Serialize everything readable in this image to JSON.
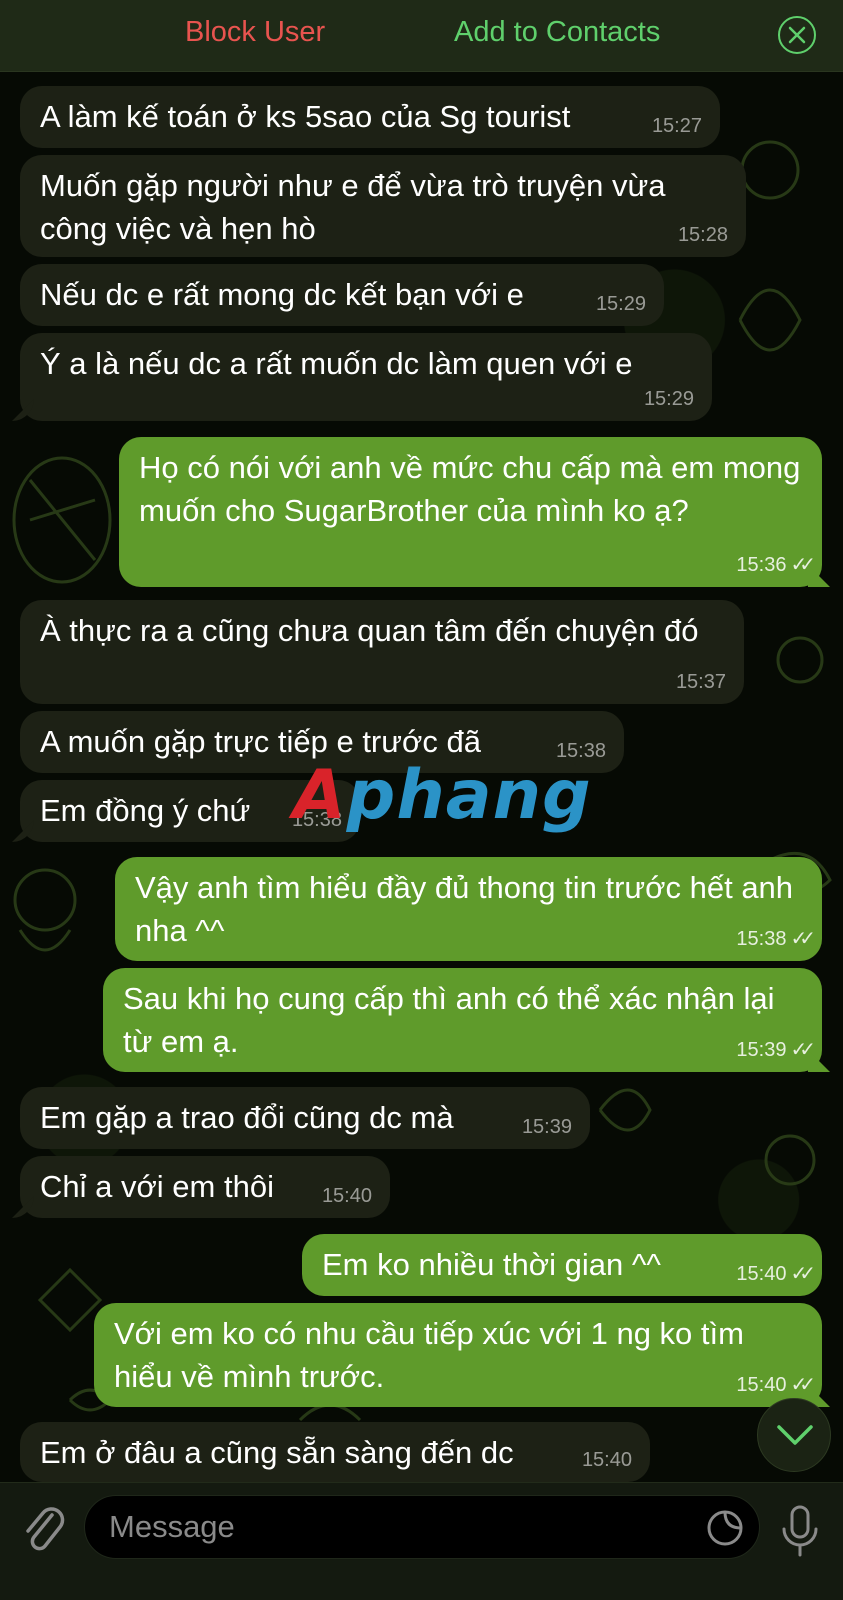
{
  "topbar": {
    "block_label": "Block User",
    "add_label": "Add to Contacts",
    "close_icon": "close-circle-icon"
  },
  "messages": [
    {
      "dir": "in",
      "text": "A làm kế toán ở ks 5sao của Sg tourist",
      "time": "15:27"
    },
    {
      "dir": "in",
      "text": "Muốn gặp người như e để vừa trò truyện vừa công việc và hẹn hò",
      "time": "15:28"
    },
    {
      "dir": "in",
      "text": "Nếu dc e rất mong dc kết bạn với e",
      "time": "15:29"
    },
    {
      "dir": "in",
      "text": "Ý a là nếu dc a rất muốn dc làm quen với e",
      "time": "15:29"
    },
    {
      "dir": "out",
      "text": "Họ có nói với anh về mức chu cấp mà em mong muốn cho SugarBrother của mình ko ạ?",
      "time": "15:36"
    },
    {
      "dir": "in",
      "text": "À thực ra a cũng chưa quan tâm đến chuyện đó",
      "time": "15:37"
    },
    {
      "dir": "in",
      "text": "A muốn gặp trực tiếp e trước đã",
      "time": "15:38"
    },
    {
      "dir": "in",
      "text": "Em đồng ý chứ",
      "time": "15:38"
    },
    {
      "dir": "out",
      "text": "Vậy anh tìm hiểu đầy đủ thong tin trước hết anh nha ^^",
      "time": "15:38"
    },
    {
      "dir": "out",
      "text": "Sau khi họ cung cấp thì anh có thể xác nhận lại từ em ạ.",
      "time": "15:39"
    },
    {
      "dir": "in",
      "text": "Em gặp a trao đổi cũng dc mà",
      "time": "15:39"
    },
    {
      "dir": "in",
      "text": "Chỉ a với em thôi",
      "time": "15:40"
    },
    {
      "dir": "out",
      "text": "Em ko nhiều thời gian ^^",
      "time": "15:40"
    },
    {
      "dir": "out",
      "text": "Với em ko có nhu cầu tiếp xúc với 1 ng ko tìm hiểu về mình trước.",
      "time": "15:40"
    },
    {
      "dir": "in",
      "text": "Em ở đâu a cũng sẵn sàng đến dc",
      "time": "15:40"
    }
  ],
  "watermark": {
    "part1": "A",
    "part2": "phang"
  },
  "composer": {
    "placeholder": "Message",
    "value": "",
    "attach_icon": "paperclip-icon",
    "sticker_icon": "sticker-icon",
    "mic_icon": "microphone-icon"
  },
  "scroll_button_icon": "chevron-down-icon",
  "colors": {
    "incoming_bubble": "#1d2115",
    "outgoing_bubble": "#5f9b2b",
    "block_red": "#e8544f",
    "add_green": "#5fd06c"
  }
}
